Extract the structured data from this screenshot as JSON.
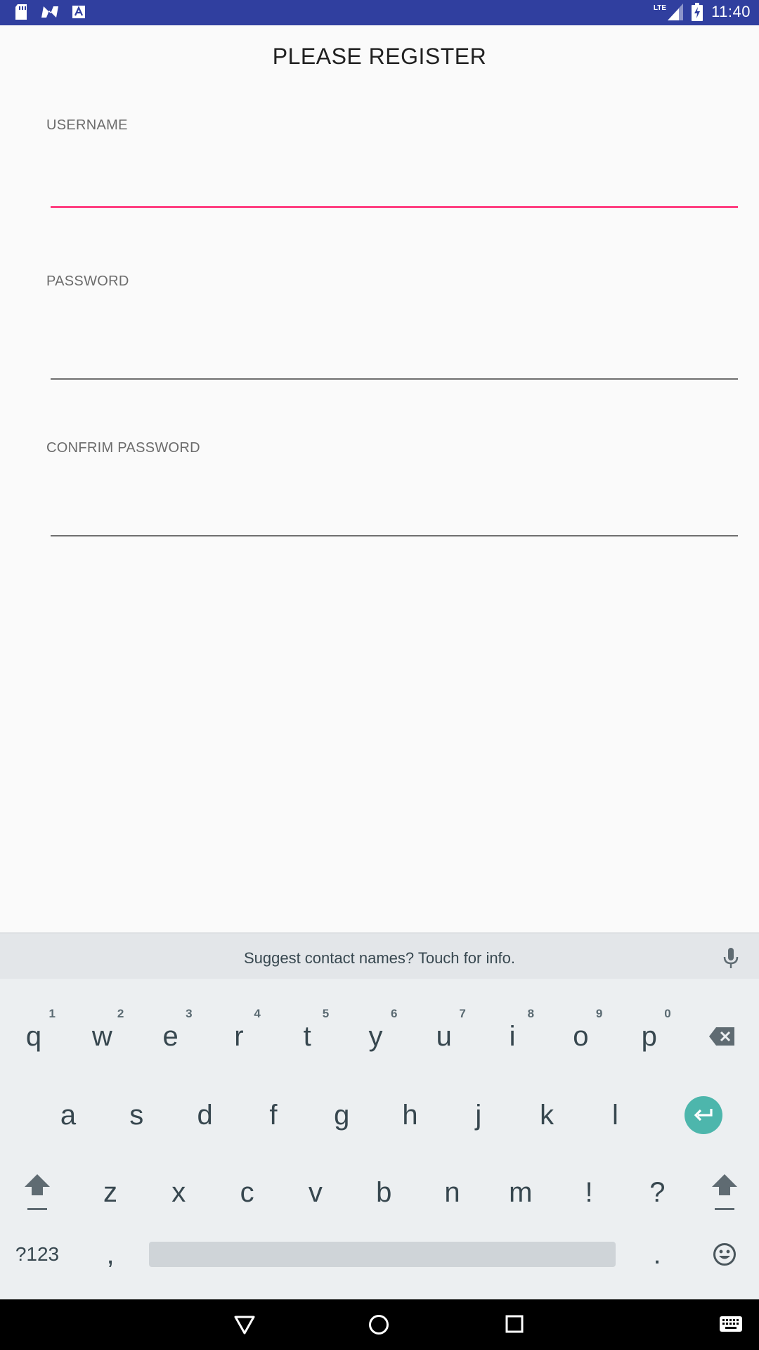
{
  "status_bar": {
    "time": "11:40",
    "network": "LTE",
    "icons": [
      "sd-card-icon",
      "n-notification-icon",
      "a-notification-icon",
      "lte-signal-icon",
      "battery-charging-icon"
    ]
  },
  "form": {
    "title": "PLEASE REGISTER",
    "username_label": "USERNAME",
    "username_value": "",
    "password_label": "PASSWORD",
    "password_value": "",
    "confirm_label": "CONFRIM PASSWORD",
    "confirm_value": "",
    "focused_field": "username",
    "accent_color": "#ff4081"
  },
  "keyboard": {
    "suggestion": "Suggest contact names? Touch for info.",
    "row1": [
      {
        "key": "q",
        "hint": "1"
      },
      {
        "key": "w",
        "hint": "2"
      },
      {
        "key": "e",
        "hint": "3"
      },
      {
        "key": "r",
        "hint": "4"
      },
      {
        "key": "t",
        "hint": "5"
      },
      {
        "key": "y",
        "hint": "6"
      },
      {
        "key": "u",
        "hint": "7"
      },
      {
        "key": "i",
        "hint": "8"
      },
      {
        "key": "o",
        "hint": "9"
      },
      {
        "key": "p",
        "hint": "0"
      }
    ],
    "row2": [
      "a",
      "s",
      "d",
      "f",
      "g",
      "h",
      "j",
      "k",
      "l"
    ],
    "row3": [
      "z",
      "x",
      "c",
      "v",
      "b",
      "n",
      "m",
      "!",
      "?"
    ],
    "symbols_label": "?123",
    "comma": ",",
    "period": ".",
    "enter_color": "#4db6ac"
  },
  "nav_bar": {
    "icons": [
      "back-icon",
      "home-icon",
      "recents-icon",
      "keyboard-switch-icon"
    ]
  }
}
